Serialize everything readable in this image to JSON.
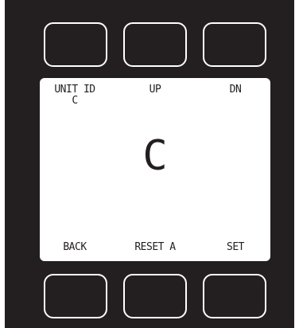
{
  "screen": {
    "top_labels": [
      "UNIT ID",
      "UP",
      "DN"
    ],
    "unit_id_value": "C",
    "display_value": "C",
    "bottom_labels": [
      "BACK",
      "RESET A",
      "SET"
    ]
  },
  "colors": {
    "bezel": "#231f20",
    "lcd_background": "#ffffff",
    "key_outline": "#ffffff",
    "text": "#231f20"
  }
}
